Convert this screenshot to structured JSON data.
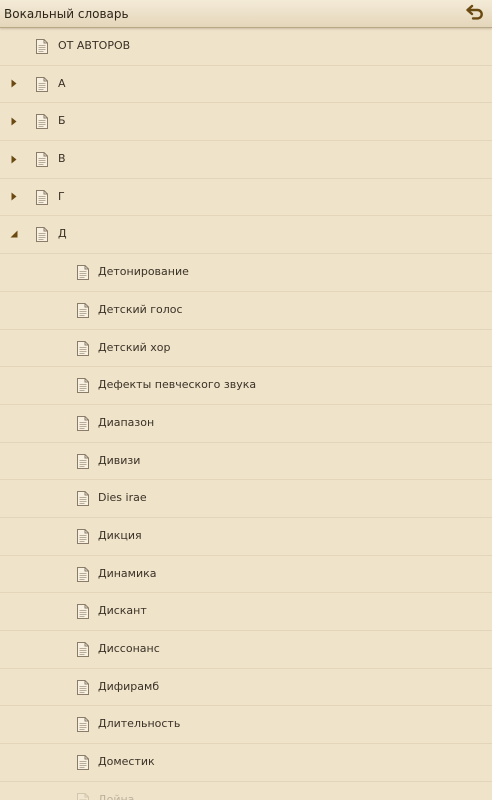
{
  "app": {
    "title": "Вокальный словарь",
    "back_icon": "undo-arrow-icon",
    "accent": "#6b4a12"
  },
  "tree": {
    "top_items": [
      {
        "label": "ОТ АВТОРОВ",
        "icon": "document-icon"
      },
      {
        "label": "А",
        "icon": "document-icon",
        "state": "collapsed"
      },
      {
        "label": "Б",
        "icon": "document-icon",
        "state": "collapsed"
      },
      {
        "label": "В",
        "icon": "document-icon",
        "state": "collapsed"
      },
      {
        "label": "Г",
        "icon": "document-icon",
        "state": "collapsed"
      },
      {
        "label": "Д",
        "icon": "document-icon",
        "state": "expanded"
      }
    ],
    "d_children": [
      {
        "label": "Детонирование"
      },
      {
        "label": "Детский голос"
      },
      {
        "label": "Детский хор"
      },
      {
        "label": "Дефекты певческого звука"
      },
      {
        "label": "Диапазон"
      },
      {
        "label": "Дивизи"
      },
      {
        "label": "Dies irae"
      },
      {
        "label": "Дикция"
      },
      {
        "label": "Динамика"
      },
      {
        "label": "Дискант"
      },
      {
        "label": "Диссонанс"
      },
      {
        "label": "Дифирамб"
      },
      {
        "label": "Длительность"
      },
      {
        "label": "Доместик"
      },
      {
        "label": "Дойна"
      }
    ]
  }
}
